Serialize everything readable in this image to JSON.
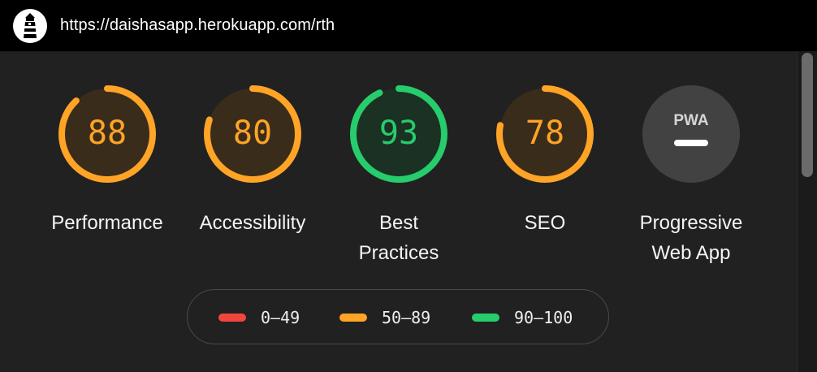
{
  "browser": {
    "url": "https://daishasapp.herokuapp.com/rth"
  },
  "gauges": [
    {
      "label": "Performance",
      "score": 88,
      "display": "88",
      "color": "#ffa426",
      "fill": "#3a2c1b"
    },
    {
      "label": "Accessibility",
      "score": 80,
      "display": "80",
      "color": "#ffa426",
      "fill": "#3a2c1b"
    },
    {
      "label": "Best Practices",
      "score": 93,
      "display": "93",
      "color": "#27cc6c",
      "fill": "#1a3124"
    },
    {
      "label": "SEO",
      "score": 78,
      "display": "78",
      "color": "#ffa426",
      "fill": "#3a2c1b"
    }
  ],
  "pwa": {
    "badge": "PWA",
    "label": "Progressive Web App"
  },
  "legend": [
    {
      "range": "0–49",
      "color": "#f1463d"
    },
    {
      "range": "50–89",
      "color": "#ffa426"
    },
    {
      "range": "90–100",
      "color": "#27cc6c"
    }
  ],
  "icons": {
    "logo": "lighthouse-icon"
  }
}
